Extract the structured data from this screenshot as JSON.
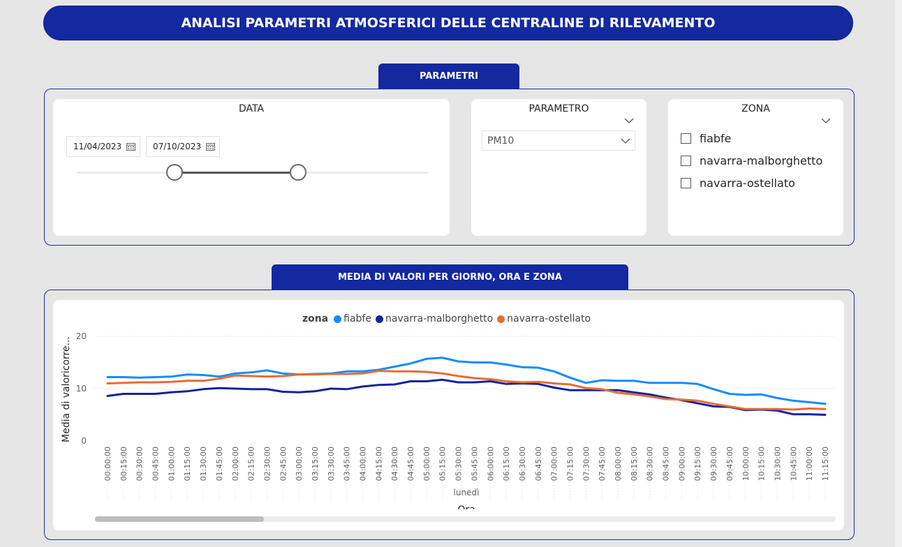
{
  "header": {
    "title": "ANALISI PARAMETRI ATMOSFERICI DELLE CENTRALINE DI RILEVAMENTO"
  },
  "parametri_section": {
    "tab_label": "PARAMETRI",
    "data_card": {
      "title": "DATA",
      "start_date": "11/04/2023",
      "end_date": "07/10/2023",
      "range_start_fraction": 0.28,
      "range_end_fraction": 0.63
    },
    "parametro_card": {
      "title": "PARAMETRO",
      "selected": "PM10"
    },
    "zona_card": {
      "title": "ZONA",
      "options": [
        {
          "label": "fiabfe",
          "checked": false
        },
        {
          "label": "navarra-malborghetto",
          "checked": false
        },
        {
          "label": "navarra-ostellato",
          "checked": false
        }
      ]
    }
  },
  "chart_section": {
    "tab_label": "MEDIA DI VALORI PER GIORNO, ORA E ZONA",
    "legend_title": "zona",
    "y_axis_label": "Media di valoricorre...",
    "x_group_label": "lunedì",
    "x_axis_label": "Ora",
    "scroll_fraction": 0.23
  },
  "colors": {
    "primary": "#1428a0",
    "fiabfe": "#118dff",
    "navarra-malborghetto": "#12239e",
    "navarra-ostellato": "#e66c37"
  },
  "chart_data": {
    "type": "line",
    "title": "",
    "xlabel": "Ora",
    "ylabel": "Media di valoricorre...",
    "ylim": [
      0,
      20
    ],
    "yticks": [
      0,
      10,
      20
    ],
    "grid": true,
    "legend_position": "top-center",
    "x": [
      "00:00:00",
      "00:15:00",
      "00:30:00",
      "00:45:00",
      "01:00:00",
      "01:15:00",
      "01:30:00",
      "01:45:00",
      "02:00:00",
      "02:15:00",
      "02:30:00",
      "02:45:00",
      "03:00:00",
      "03:15:00",
      "03:30:00",
      "03:45:00",
      "04:00:00",
      "04:15:00",
      "04:30:00",
      "04:45:00",
      "05:00:00",
      "05:15:00",
      "05:30:00",
      "05:45:00",
      "06:00:00",
      "06:15:00",
      "06:30:00",
      "06:45:00",
      "07:00:00",
      "07:15:00",
      "07:30:00",
      "07:45:00",
      "08:00:00",
      "08:15:00",
      "08:30:00",
      "08:45:00",
      "09:00:00",
      "09:15:00",
      "09:30:00",
      "09:45:00",
      "10:00:00",
      "10:15:00",
      "10:30:00",
      "10:45:00",
      "11:00:00",
      "11:15:00"
    ],
    "series": [
      {
        "name": "fiabfe",
        "color": "#118dff",
        "values": [
          12.2,
          12.2,
          12.1,
          12.2,
          12.3,
          12.7,
          12.6,
          12.3,
          12.9,
          13.1,
          13.5,
          12.9,
          12.7,
          12.8,
          12.9,
          13.3,
          13.3,
          13.6,
          14.2,
          14.8,
          15.7,
          15.9,
          15.2,
          15.0,
          15.0,
          14.6,
          14.1,
          14.0,
          13.3,
          12.1,
          11.1,
          11.6,
          11.5,
          11.5,
          11.1,
          11.1,
          11.1,
          10.9,
          9.9,
          9.0,
          8.8,
          8.9,
          8.2,
          7.7,
          7.4,
          7.1
        ]
      },
      {
        "name": "navarra-malborghetto",
        "color": "#12239e",
        "values": [
          8.6,
          9.0,
          9.0,
          9.0,
          9.3,
          9.5,
          9.9,
          10.1,
          10.0,
          9.9,
          9.9,
          9.4,
          9.3,
          9.5,
          10.0,
          9.9,
          10.4,
          10.7,
          10.8,
          11.4,
          11.4,
          11.7,
          11.2,
          11.2,
          11.4,
          10.9,
          11.0,
          10.9,
          10.2,
          9.7,
          9.7,
          9.7,
          9.7,
          9.3,
          8.9,
          8.3,
          7.8,
          7.2,
          6.6,
          6.5,
          5.9,
          6.0,
          5.8,
          5.1,
          5.1,
          5.0
        ]
      },
      {
        "name": "navarra-ostellato",
        "color": "#e66c37",
        "values": [
          11.0,
          11.1,
          11.2,
          11.2,
          11.3,
          11.5,
          11.5,
          11.9,
          12.5,
          12.4,
          12.3,
          12.4,
          12.7,
          12.7,
          12.8,
          12.8,
          12.9,
          13.4,
          13.3,
          13.3,
          13.2,
          12.9,
          12.4,
          12.0,
          11.8,
          11.4,
          11.2,
          11.3,
          11.0,
          10.8,
          10.1,
          9.9,
          9.2,
          8.9,
          8.5,
          8.0,
          7.9,
          7.7,
          7.1,
          6.6,
          6.1,
          6.1,
          6.1,
          6.0,
          6.2,
          6.1
        ]
      }
    ]
  }
}
